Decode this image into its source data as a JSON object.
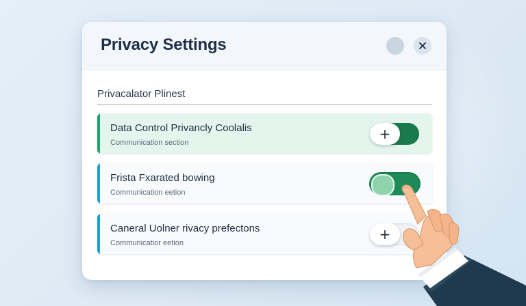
{
  "dialog": {
    "title": "Privacy Settings",
    "close_icon": "close-icon"
  },
  "section": {
    "label": "Privacalator Plinest"
  },
  "rows": [
    {
      "title": "Data Control Privancly Coolalis",
      "subtitle": "Communication section",
      "control": "plus-toggle",
      "state": "on",
      "accent": "#1aa36b",
      "active": true
    },
    {
      "title": "Frista Fxarated bowing",
      "subtitle": "Communication eetion",
      "control": "switch",
      "state": "on",
      "accent": "#1aa0d6",
      "active": false
    },
    {
      "title": "Caneral Uolner rivacy prefectons",
      "subtitle": "Communicatior eetion",
      "control": "plus-toggle",
      "state": "off",
      "accent": "#1aa0d6",
      "active": false
    }
  ],
  "colors": {
    "brand_green": "#1c8b57",
    "accent_blue": "#1aa0d6",
    "accent_green": "#1aa36b"
  },
  "icons": [
    "close-icon",
    "plus-icon",
    "pointing-hand-icon"
  ]
}
